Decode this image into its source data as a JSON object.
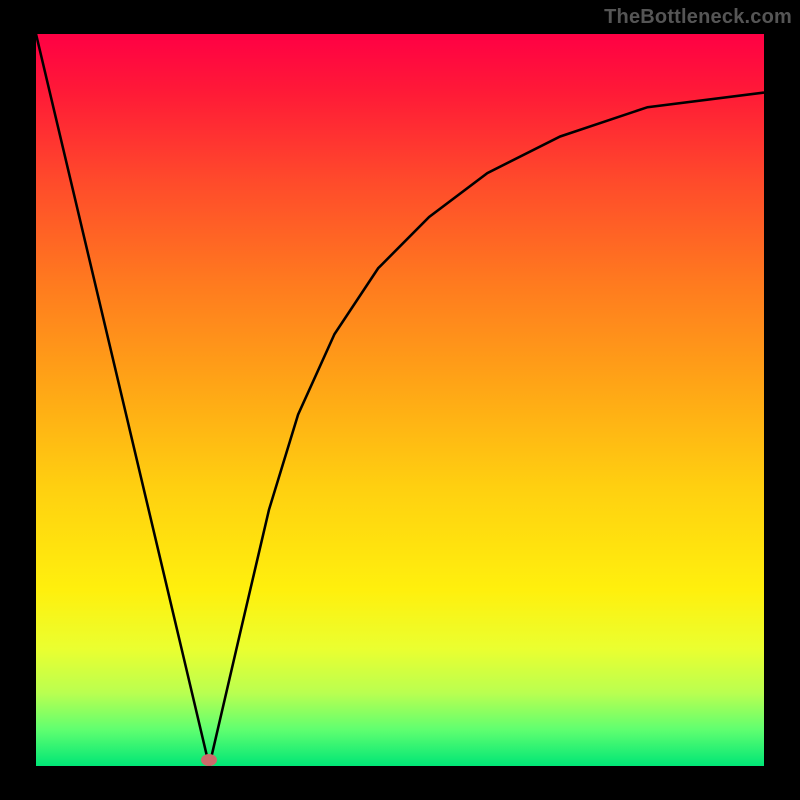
{
  "watermark": "TheBottleneck.com",
  "chart_data": {
    "type": "line",
    "title": "",
    "xlabel": "",
    "ylabel": "",
    "xlim": [
      0,
      100
    ],
    "ylim": [
      0,
      100
    ],
    "series": [
      {
        "name": "curve",
        "x": [
          0,
          5,
          10,
          15,
          20,
          23.8,
          28,
          32,
          36,
          41,
          47,
          54,
          62,
          72,
          84,
          100
        ],
        "values": [
          100,
          79,
          58,
          37,
          16,
          0,
          18,
          35,
          48,
          59,
          68,
          75,
          81,
          86,
          90,
          92
        ]
      }
    ],
    "marker": {
      "x": 23.8,
      "y": 0.8
    },
    "grid": false,
    "legend": false,
    "background_gradient": [
      "#ff0044",
      "#ff7a1f",
      "#fff00d",
      "#00e676"
    ]
  }
}
